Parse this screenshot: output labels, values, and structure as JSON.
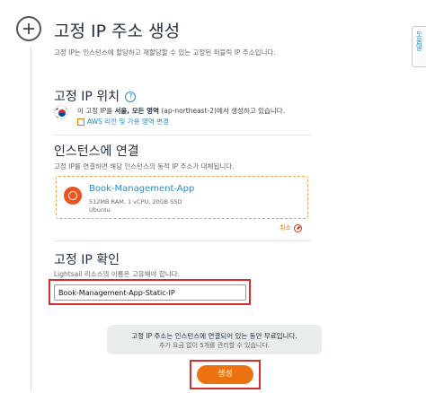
{
  "header": {
    "title": "고정 IP 주소 생성",
    "subtitle": "고정 IP는 인스턴스에 할당하고 재할당할 수 있는 고정된 퍼블릭 IP 주소입니다."
  },
  "help_tab": {
    "label": "도움말"
  },
  "location": {
    "title": "고정 IP 위치",
    "help_icon": "question-icon",
    "line_prefix": "이 고정 IP를 ",
    "region_bold": "서울, 모든 영역",
    "line_suffix": " (ap-northeast-2)에서 생성하고 있습니다.",
    "change_link": "AWS 리전 및 가용 영역 변경"
  },
  "attach": {
    "title": "인스턴스에 연결",
    "description": "고정 IP를 연결하면 해당 인스턴스의 동적 IP 주소가 대체됩니다.",
    "instance": {
      "name": "Book-Management-App",
      "spec": "512MB RAM, 1 vCPU, 20GB SSD",
      "os": "Ubuntu"
    },
    "cancel_label": "취소"
  },
  "confirm": {
    "title": "고정 IP 확인",
    "description": "Lightsail 리소스의 이름은 고유해야 합니다.",
    "name_value": "Book-Management-App-Static-IP"
  },
  "notice": {
    "line1": "고정 IP 주소는 인스턴스에 연결되어 있는 동안 무료입니다.",
    "line2": "추가 요금 없이 5개를 관리할 수 있습니다."
  },
  "actions": {
    "create_label": "생성"
  },
  "colors": {
    "accent": "#ec7211",
    "link": "#2d8ac7",
    "highlight": "#d42f2f"
  }
}
